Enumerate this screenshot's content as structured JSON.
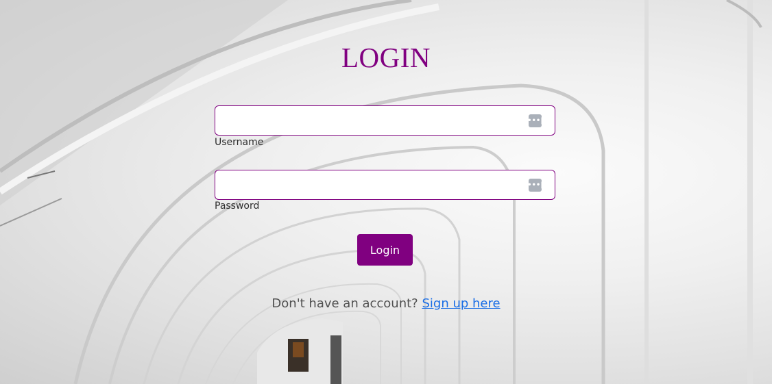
{
  "page": {
    "title": "LOGIN"
  },
  "form": {
    "username": {
      "label": "Username",
      "value": "",
      "placeholder": ""
    },
    "password": {
      "label": "Password",
      "value": "",
      "placeholder": ""
    },
    "submit_label": "Login",
    "field_icon": "password-manager-icon"
  },
  "footer": {
    "prompt": "Don't have an account?",
    "link_text": "Sign up here"
  },
  "colors": {
    "accent": "#800080",
    "link": "#1a6ee6",
    "icon": "#aab0b9"
  }
}
